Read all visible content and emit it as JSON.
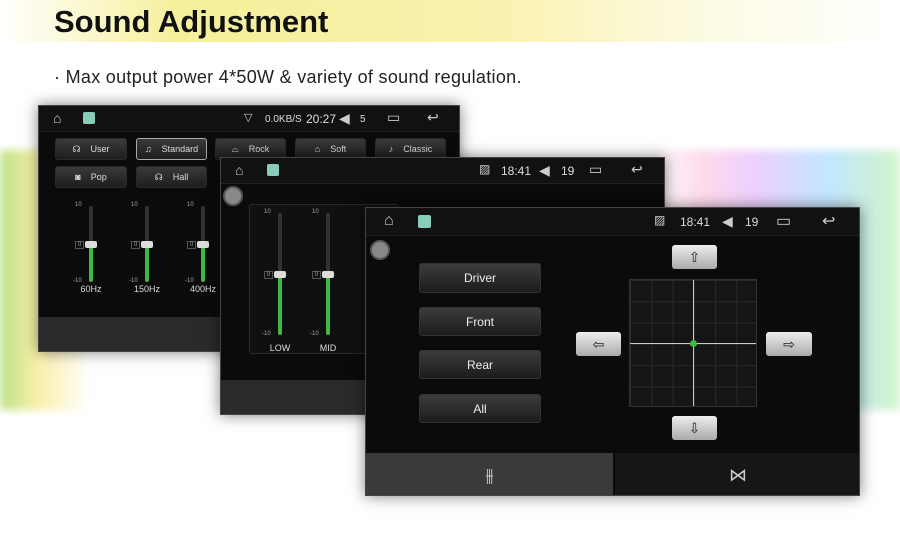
{
  "header": {
    "title": "Sound Adjustment",
    "subtitle": "· Max output power 4*50W & variety of sound regulation."
  },
  "screen1": {
    "status": {
      "net": "0.0KB/S",
      "time": "20:27",
      "volume": "5"
    },
    "presets": [
      "User",
      "Standard",
      "Rock",
      "Soft",
      "Classic",
      "Pop",
      "Hall"
    ],
    "selected_preset": "Standard",
    "bands": [
      {
        "label": "60Hz",
        "value": 0
      },
      {
        "label": "150Hz",
        "value": 0
      },
      {
        "label": "400Hz",
        "value": 0
      }
    ],
    "scale": {
      "max": "10",
      "mid": "0",
      "min": "-10"
    }
  },
  "screen2": {
    "status": {
      "time": "18:41",
      "volume": "19"
    },
    "bands": [
      {
        "label": "LOW",
        "value": 0
      },
      {
        "label": "MID",
        "value": 0
      }
    ],
    "scale": {
      "max": "10",
      "mid": "0",
      "min": "-10"
    }
  },
  "screen3": {
    "status": {
      "time": "18:41",
      "volume": "19"
    },
    "zones": [
      "Driver",
      "Front",
      "Rear",
      "All"
    ],
    "balance": {
      "x": 0,
      "y": 0
    },
    "accent": "#3fb93f"
  },
  "icons": {
    "home": "home-icon",
    "app": "app-icon",
    "back": "back-icon",
    "recents": "recents-icon",
    "speaker": "speaker-icon",
    "eq": "equalizer-icon",
    "surround": "surround-icon"
  }
}
